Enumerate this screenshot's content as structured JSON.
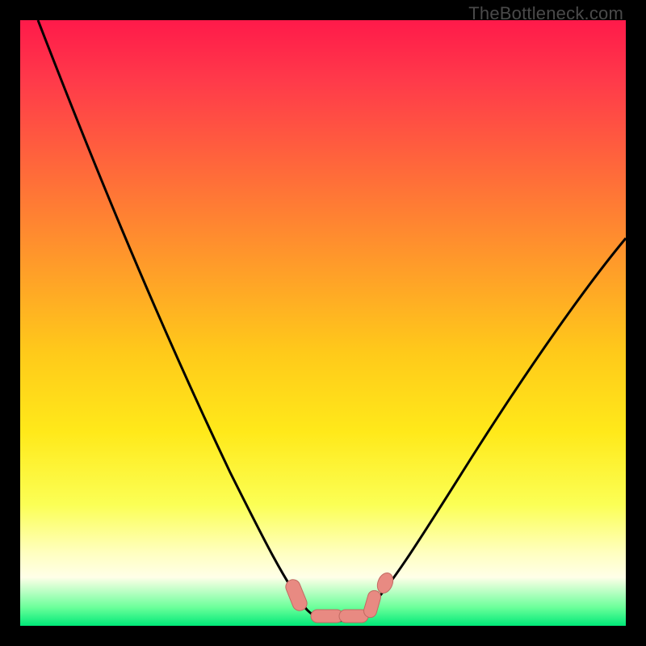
{
  "watermark": "TheBottleneck.com",
  "chart_data": {
    "type": "line",
    "title": "",
    "xlabel": "",
    "ylabel": "",
    "xlim": [
      0,
      100
    ],
    "ylim": [
      0,
      100
    ],
    "grid": false,
    "series": [
      {
        "name": "bottleneck-curve",
        "x": [
          3,
          10,
          20,
          30,
          40,
          45,
          48,
          50,
          52,
          55,
          58,
          60,
          65,
          70,
          80,
          90,
          100
        ],
        "y": [
          100,
          80,
          58,
          38,
          18,
          8,
          3,
          1,
          1,
          1,
          3,
          6,
          12,
          20,
          35,
          50,
          62
        ]
      }
    ],
    "markers": [
      {
        "name": "marker-trough-left",
        "x": 45,
        "y": 4
      },
      {
        "name": "marker-trough-bottom1",
        "x": 49,
        "y": 1
      },
      {
        "name": "marker-trough-bottom2",
        "x": 53,
        "y": 1
      },
      {
        "name": "marker-trough-right",
        "x": 57,
        "y": 2
      },
      {
        "name": "marker-trough-up",
        "x": 59,
        "y": 5
      }
    ],
    "marker_color": "#e88a82",
    "background_gradient": [
      "#ff1a4a",
      "#ffca1a",
      "#fbff55",
      "#00e878"
    ]
  }
}
